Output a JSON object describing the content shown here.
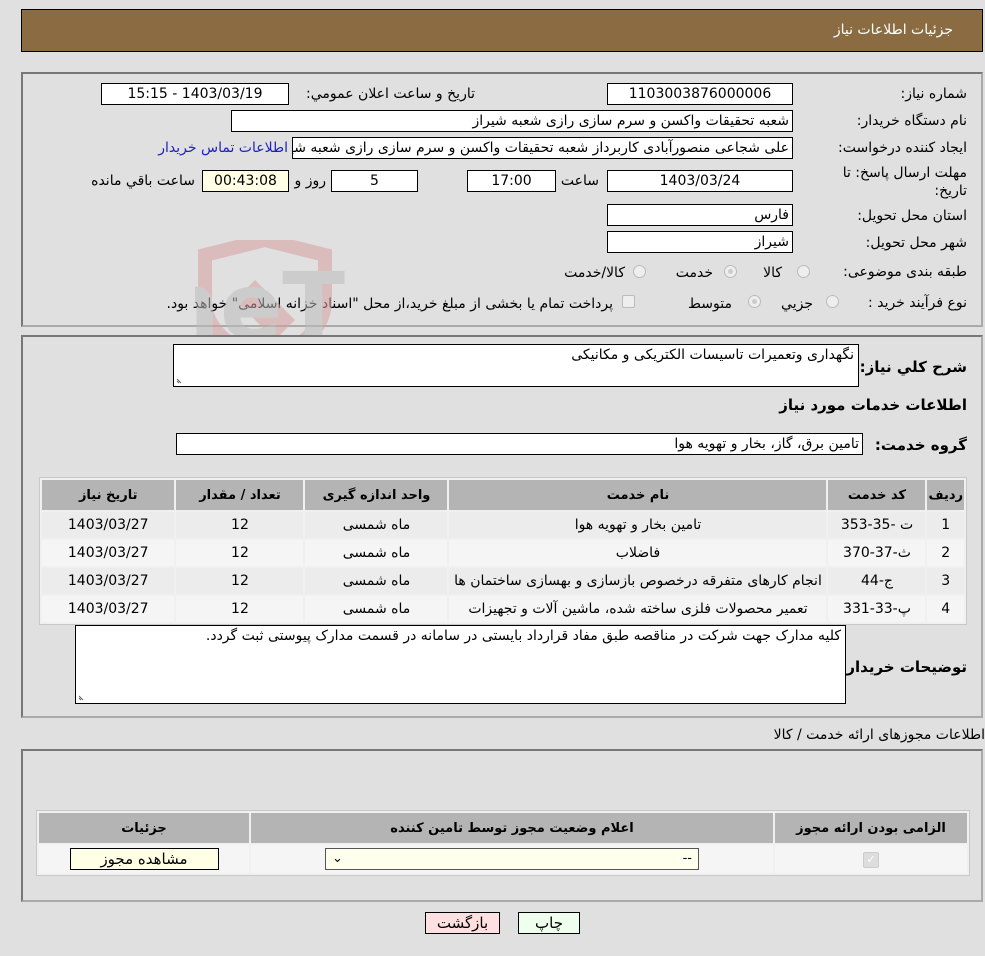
{
  "header": {
    "title": "جزئیات اطلاعات نیاز"
  },
  "form": {
    "need_number": {
      "label": "شماره نیاز:",
      "value": "1103003876000006"
    },
    "announce_datetime": {
      "label": "تاریخ و ساعت اعلان عمومي:",
      "value": "1403/03/19 - 15:15"
    },
    "buyer_org": {
      "label": "نام دستگاه خریدار:",
      "value": "شعبه تحقیقات واکسن و سرم سازی رازی  شعبه شیراز"
    },
    "requester": {
      "label": "ایجاد کننده درخواست:",
      "value": "علی شجاعی منصورآبادی کاربرداز شعبه تحقیقات واکسن و سرم سازی رازی  شعبه شیراز",
      "contact_link": "اطلاعات تماس خریدار"
    },
    "deadline": {
      "label": "مهلت ارسال پاسخ: تا تاریخ:",
      "date": "1403/03/24",
      "time_label": "ساعت",
      "time": "17:00",
      "days": "5",
      "days_label": "روز و",
      "remaining": "00:43:08",
      "remaining_label": "ساعت باقي مانده"
    },
    "province": {
      "label": "استان محل تحویل:",
      "value": "فارس"
    },
    "city": {
      "label": "شهر محل تحویل:",
      "value": "شیراز"
    },
    "category": {
      "label": "طبقه بندی موضوعی:",
      "options": [
        "کالا",
        "خدمت",
        "کالا/خدمت"
      ],
      "selected": "خدمت"
    },
    "purchase_type": {
      "label": "نوع فرآیند خرید :",
      "options": [
        "جزیي",
        "متوسط"
      ],
      "selected": "متوسط",
      "treasury_note": "پرداخت تمام یا بخشی از مبلغ خرید،از محل \"اسناد خزانه اسلامی\" خواهد بود."
    }
  },
  "description": {
    "label": "شرح کلي نیاز:",
    "value": "نگهداری وتعمیرات تاسیسات الکتریکی و مکانیکی"
  },
  "services": {
    "section_title": "اطلاعات خدمات مورد نیاز",
    "group_label": "گروه خدمت:",
    "group_value": "تامین برق، گاز، بخار و تهویه هوا",
    "columns": [
      "ردیف",
      "کد خدمت",
      "نام خدمت",
      "واحد اندازه گیری",
      "تعداد / مقدار",
      "تاریخ نیاز"
    ],
    "rows": [
      {
        "row": "1",
        "code": "ت -35-353",
        "name": "تامین بخار و تهویه هوا",
        "unit": "ماه شمسی",
        "qty": "12",
        "date": "1403/03/27"
      },
      {
        "row": "2",
        "code": "ث-37-370",
        "name": "فاضلاب",
        "unit": "ماه شمسی",
        "qty": "12",
        "date": "1403/03/27"
      },
      {
        "row": "3",
        "code": "ج-44",
        "name": "انجام کارهای متفرقه درخصوص بازسازی و بهسازی ساختمان ها",
        "unit": "ماه شمسی",
        "qty": "12",
        "date": "1403/03/27"
      },
      {
        "row": "4",
        "code": "پ-33-331",
        "name": "تعمیر محصولات فلزی ساخته شده، ماشین آلات و تجهیزات",
        "unit": "ماه شمسی",
        "qty": "12",
        "date": "1403/03/27"
      }
    ]
  },
  "buyer_notes": {
    "label": "توضیحات خریدار:",
    "value": "کلیه مدارک جهت شرکت در مناقصه طبق مفاد قرارداد بایستی در سامانه در قسمت مدارک پیوستی ثبت گردد."
  },
  "licenses": {
    "section_title": "اطلاعات مجوزهای ارائه خدمت / کالا",
    "columns": [
      "الزامی بودن ارائه مجوز",
      "اعلام وضعیت مجوز توسط تامین کننده",
      "جزئیات"
    ],
    "row": {
      "required": true,
      "status": "--",
      "details_button": "مشاهده مجوز"
    }
  },
  "footer": {
    "print_button": "چاپ",
    "back_button": "بازگشت"
  },
  "watermark": {
    "text": "AriaTender.neT"
  },
  "colors": {
    "header_bg": "#8b6c42",
    "link": "#2020c0",
    "back_btn": "#ffe0e0",
    "print_btn": "#eeffee"
  }
}
